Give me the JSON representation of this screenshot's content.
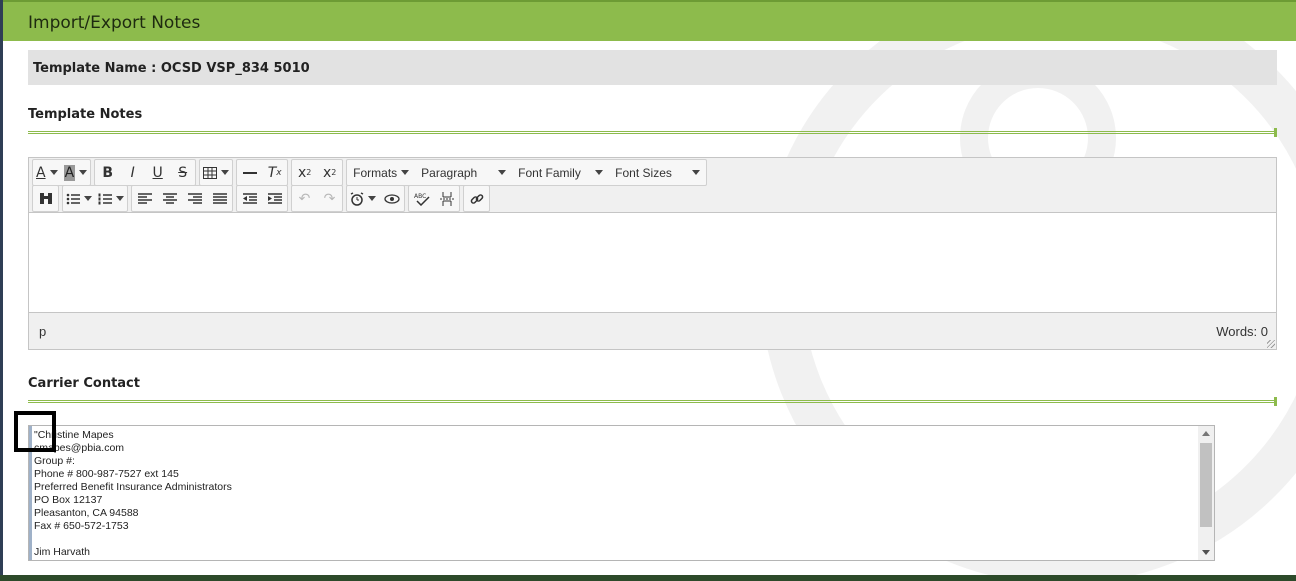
{
  "header": {
    "title": "Import/Export Notes"
  },
  "template": {
    "label": "Template Name : OCSD VSP_834 5010"
  },
  "notes_section": {
    "title": "Template Notes"
  },
  "editor": {
    "dropdowns": {
      "formats": "Formats",
      "paragraph": "Paragraph",
      "font_family": "Font Family",
      "font_sizes": "Font Sizes"
    },
    "status_path": "p",
    "word_count": "Words: 0"
  },
  "carrier_section": {
    "title": "Carrier Contact",
    "contact_text": "\"Christine Mapes\ncmapes@pbia.com\nGroup #:\nPhone # 800-987-7527 ext 145\nPreferred Benefit Insurance Administrators\nPO Box 12137\nPleasanton, CA 94588\nFax # 650-572-1753\n\nJim Harvath"
  },
  "colors": {
    "header_green": "#8dbb4c",
    "rule_green": "#8dbb4c",
    "bar_gray": "#e2e2e2"
  }
}
